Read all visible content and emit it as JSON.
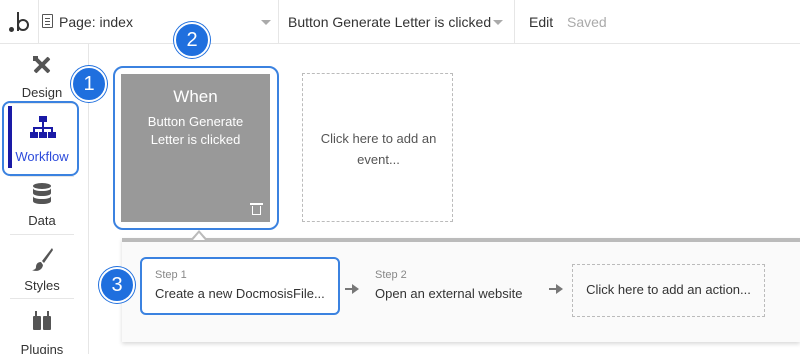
{
  "topbar": {
    "logo_icon": "bubble-logo-icon",
    "page_icon": "page-icon",
    "page_label": "Page: index",
    "event_label": "Button Generate Letter is clicked",
    "edit_label": "Edit",
    "status": "Saved"
  },
  "sidebar": {
    "items": [
      {
        "label": "Design",
        "icon": "design-tools-icon",
        "active": false
      },
      {
        "label": "Workflow",
        "icon": "workflow-sitemap-icon",
        "active": true
      },
      {
        "label": "Data",
        "icon": "database-icon",
        "active": false
      },
      {
        "label": "Styles",
        "icon": "paint-brush-icon",
        "active": false
      },
      {
        "label": "Plugins",
        "icon": "plug-icon",
        "active": false
      }
    ]
  },
  "callouts": [
    "1",
    "2",
    "3"
  ],
  "event_card": {
    "title": "When",
    "description": "Button Generate Letter is clicked",
    "icon": "trash-icon"
  },
  "add_event": {
    "label": "Click here to add an event..."
  },
  "actions": {
    "steps": [
      {
        "number": "Step 1",
        "label": "Create a new DocmosisFile..."
      },
      {
        "number": "Step 2",
        "label": "Open an external website"
      }
    ],
    "add_action": "Click here to add an action..."
  },
  "colors": {
    "accent": "#2d4bdb",
    "callout": "#1f6fde",
    "highlight": "#3b82e0",
    "event_card_bg": "#999999"
  }
}
